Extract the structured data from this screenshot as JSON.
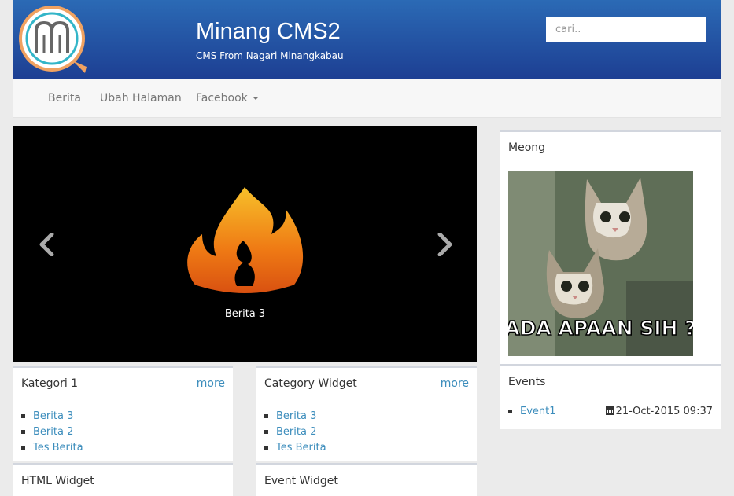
{
  "site": {
    "title": "Minang CMS2",
    "subtitle": "CMS From Nagari Minangkabau"
  },
  "search": {
    "placeholder": "cari.."
  },
  "nav": {
    "items": [
      "Berita",
      "Ubah Halaman",
      "Facebook"
    ]
  },
  "carousel": {
    "caption": "Berita 3"
  },
  "widgets": {
    "kategori": {
      "title": "Kategori 1",
      "more": "more",
      "items": [
        "Berita 3",
        "Berita 2",
        "Tes Berita"
      ]
    },
    "category": {
      "title": "Category Widget",
      "more": "more",
      "items": [
        "Berita 3",
        "Berita 2",
        "Tes Berita"
      ]
    },
    "html": {
      "title": "HTML Widget"
    },
    "event": {
      "title": "Event Widget"
    }
  },
  "sidebar": {
    "meong": {
      "title": "Meong",
      "image_text": "ADA APAAN SIH ?"
    },
    "events": {
      "title": "Events",
      "items": [
        {
          "name": "Event1",
          "date": "21-Oct-2015 09:37"
        }
      ]
    }
  },
  "colors": {
    "header_top": "#2b6ab5",
    "header_bottom": "#1d3f93",
    "link": "#3c8dbc",
    "logo_ring": "#f0a261",
    "logo_inner": "#33b5c8"
  }
}
